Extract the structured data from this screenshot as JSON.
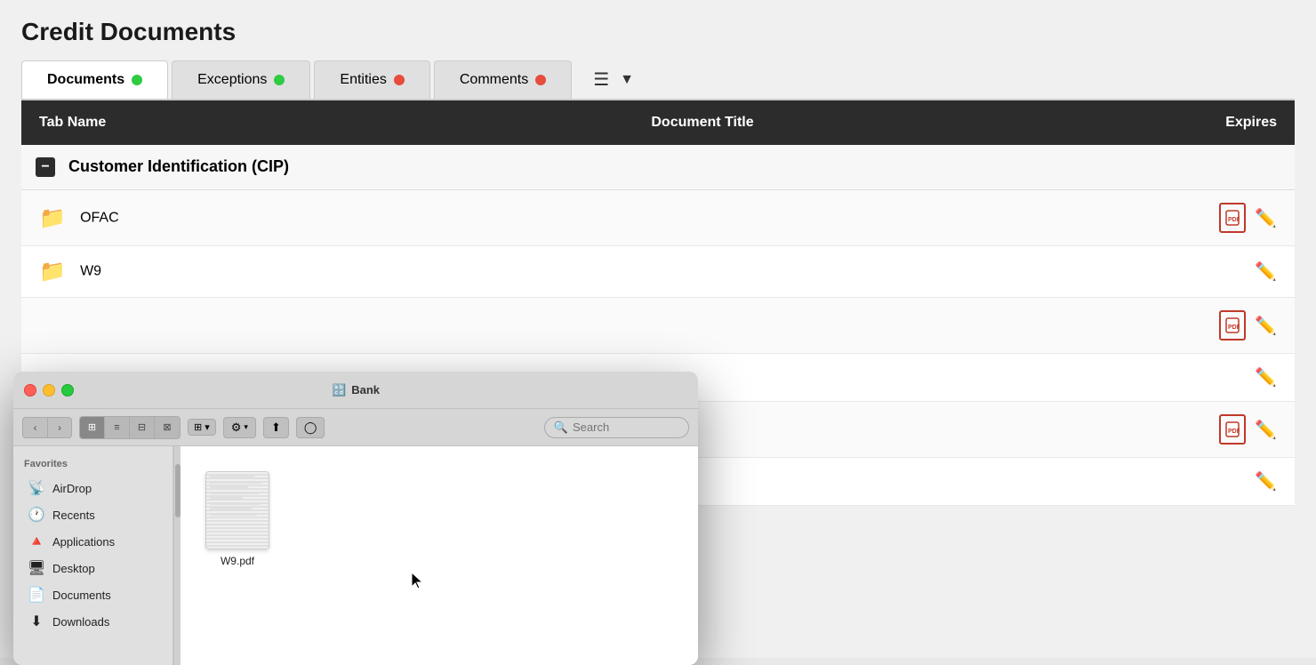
{
  "page": {
    "title": "Credit Documents"
  },
  "tabs": [
    {
      "id": "documents",
      "label": "Documents",
      "dot": "green",
      "active": true
    },
    {
      "id": "exceptions",
      "label": "Exceptions",
      "dot": "green",
      "active": false
    },
    {
      "id": "entities",
      "label": "Entities",
      "dot": "red",
      "active": false
    },
    {
      "id": "comments",
      "label": "Comments",
      "dot": "red",
      "active": false
    }
  ],
  "table": {
    "headers": [
      "Tab Name",
      "Document Title",
      "Expires"
    ],
    "sections": [
      {
        "name": "Customer Identification (CIP)",
        "rows": [
          {
            "name": "OFAC",
            "status": "green",
            "hasPdf": true,
            "hasPencil": true
          },
          {
            "name": "W9",
            "status": "red",
            "hasPdf": false,
            "hasPencil": true
          }
        ]
      }
    ],
    "extraRows": [
      {
        "status": "green",
        "hasPdf": true,
        "hasPencil": true
      },
      {
        "status": "red",
        "hasPdf": false,
        "hasPencil": true
      },
      {
        "status": "green",
        "hasPdf": true,
        "hasPencil": true
      },
      {
        "status": "red",
        "hasPdf": false,
        "hasPencil": true
      }
    ]
  },
  "finder": {
    "title": "Bank",
    "titleIcon": "🔡",
    "search": {
      "placeholder": "Search"
    },
    "sidebar": {
      "sectionLabel": "Favorites",
      "items": [
        {
          "id": "airdrop",
          "icon": "📡",
          "label": "AirDrop"
        },
        {
          "id": "recents",
          "icon": "🕐",
          "label": "Recents"
        },
        {
          "id": "applications",
          "icon": "🔺",
          "label": "Applications"
        },
        {
          "id": "desktop",
          "icon": "🖥",
          "label": "Desktop"
        },
        {
          "id": "documents",
          "icon": "📄",
          "label": "Documents"
        },
        {
          "id": "downloads",
          "icon": "⬇",
          "label": "Downloads"
        }
      ]
    },
    "file": {
      "name": "W9.pdf",
      "type": "pdf"
    },
    "toolbar": {
      "back": "‹",
      "forward": "›",
      "views": [
        "⊞",
        "≡",
        "⊟",
        "⊠"
      ],
      "gear": "⚙",
      "share": "⬆",
      "tag": "◯"
    }
  }
}
